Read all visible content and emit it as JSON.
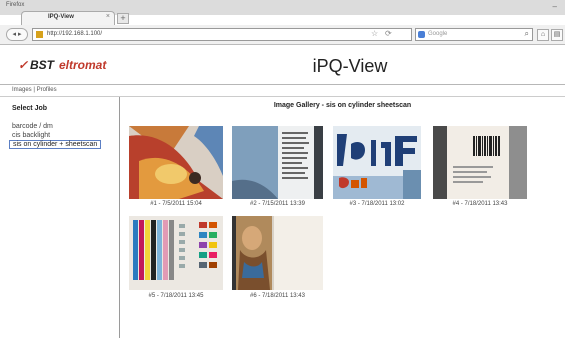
{
  "browser": {
    "app_title": "Firefox",
    "tab_label": "IPQ-View",
    "tab_close": "×",
    "new_tab": "+",
    "minimize": "–",
    "url": "http://192.168.1.100/",
    "search_placeholder": "Google",
    "nav_back_forward": "◂ ▸",
    "star": "☆",
    "reload": "⟳",
    "search_glyph": "⌕"
  },
  "header": {
    "logo_mark": "✓",
    "logo_bst": "BST",
    "logo_eltromat": "eltromat",
    "title": "iPQ-View"
  },
  "menu": {
    "items": [
      "Images",
      "Profiles"
    ],
    "separator": "|"
  },
  "sidebar": {
    "title": "Select Job",
    "jobs": [
      {
        "label": "barcode / dm",
        "selected": false
      },
      {
        "label": "cis backlight",
        "selected": false
      },
      {
        "label": "sis on cylinder + sheetscan",
        "selected": true
      }
    ]
  },
  "gallery": {
    "title": "Image Gallery - sis on cylinder sheetscan",
    "images": [
      {
        "caption": "#1 - 7/5/2011 15:04",
        "icon": "color-print-thumbnail"
      },
      {
        "caption": "#2 - 7/15/2011 13:39",
        "icon": "text-print-thumbnail"
      },
      {
        "caption": "#3 - 7/18/2011 13:02",
        "icon": "lettering-thumbnail"
      },
      {
        "caption": "#4 - 7/18/2011 13:43",
        "icon": "barcode-thumbnail"
      },
      {
        "caption": "#5 - 7/18/2011 13:45",
        "icon": "color-bars-thumbnail"
      },
      {
        "caption": "#6 - 7/18/2011 13:43",
        "icon": "photo-print-thumbnail"
      }
    ]
  },
  "colors": {
    "brand_red": "#c0392b",
    "selected_border": "#5c7fc4"
  }
}
